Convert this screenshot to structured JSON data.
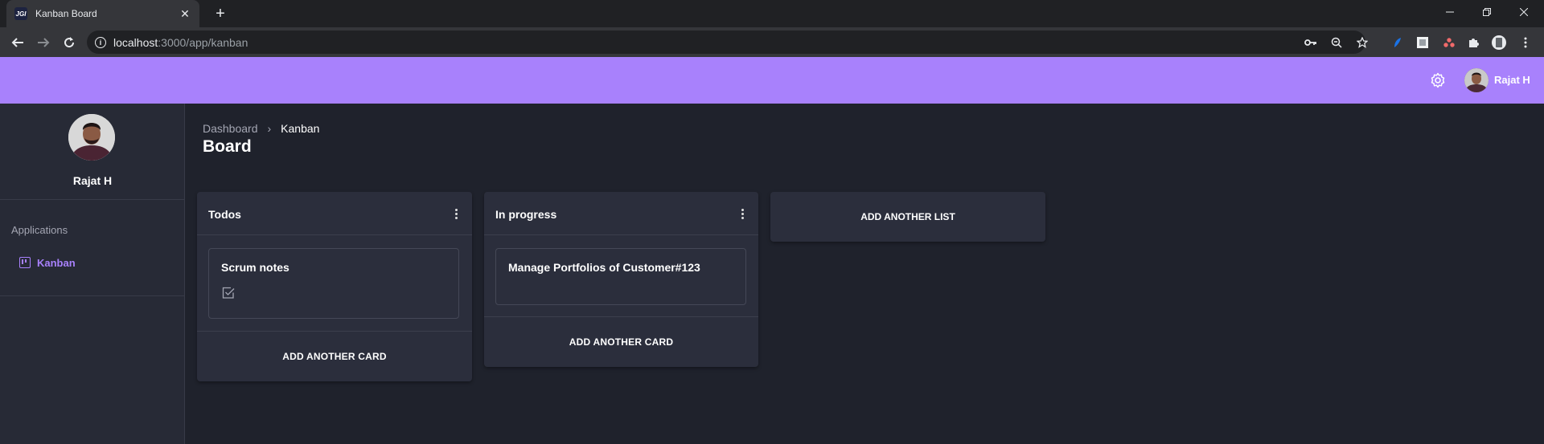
{
  "browser": {
    "tab_title": "Kanban Board",
    "favicon_text": "JGI",
    "url_host": "localhost",
    "url_rest": ":3000/app/kanban",
    "new_tab": "+",
    "close": "✕"
  },
  "header": {
    "user_name": "Rajat H",
    "accent_color": "#a881fc"
  },
  "sidebar": {
    "user_name": "Rajat H",
    "section_title": "Applications",
    "items": [
      {
        "label": "Kanban",
        "icon": "kanban-icon",
        "active": true
      }
    ]
  },
  "breadcrumb": {
    "items": [
      "Dashboard",
      "Kanban"
    ],
    "separator": "›"
  },
  "page": {
    "title": "Board"
  },
  "lists": [
    {
      "title": "Todos",
      "cards": [
        {
          "title": "Scrum notes",
          "icon": "checkbox-icon"
        }
      ],
      "add_card_label": "ADD ANOTHER CARD"
    },
    {
      "title": "In progress",
      "cards": [
        {
          "title": "Manage Portfolios of Customer#123"
        }
      ],
      "add_card_label": "ADD ANOTHER CARD"
    }
  ],
  "add_list_label": "ADD ANOTHER LIST"
}
